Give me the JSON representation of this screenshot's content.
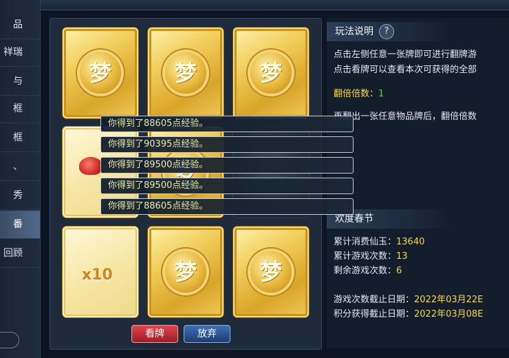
{
  "sidebar": {
    "items": [
      {
        "label": "品"
      },
      {
        "label": "祥瑞"
      },
      {
        "label": "与"
      },
      {
        "label": "框"
      },
      {
        "label": "框"
      },
      {
        "label": "、"
      },
      {
        "label": "秀"
      },
      {
        "label": "番"
      },
      {
        "label": "回顾"
      }
    ],
    "active_index": 7
  },
  "cards": [
    {
      "type": "back",
      "glyph": "梦"
    },
    {
      "type": "back",
      "glyph": "梦"
    },
    {
      "type": "back",
      "glyph": "梦"
    },
    {
      "type": "item"
    },
    {
      "type": "back",
      "glyph": "梦"
    },
    {
      "type": "dark"
    },
    {
      "type": "multiplier",
      "label": "x10"
    },
    {
      "type": "back",
      "glyph": "梦"
    },
    {
      "type": "back",
      "glyph": "梦"
    }
  ],
  "buttons": {
    "view": "看牌",
    "quit": "放弃"
  },
  "rules": {
    "title": "玩法说明",
    "help": "?",
    "line1": "点击左侧任意一张牌即可进行翻牌游",
    "line2": "点击看牌可以查看本次可获得的全部",
    "double_label": "翻倍倍数：",
    "double_value": "1",
    "line3": "再翻出一张任意物品牌后，翻倍倍数"
  },
  "event": {
    "title": "欢度春节",
    "spent_label": "累计消费仙玉：",
    "spent_value": "13640",
    "plays_label": "累计游戏次数：",
    "plays_value": "13",
    "remain_label": "剩余游戏次数：",
    "remain_value": "6",
    "deadline_label": "游戏次数截止日期：",
    "deadline_value": "2022年03月22E",
    "points_label": "积分获得截止日期：",
    "points_value": "2022年03月08E"
  },
  "messages": [
    "你得到了88605点经验。",
    "你得到了90395点经验。",
    "你得到了89500点经验。",
    "你得到了89500点经验。",
    "你得到了88605点经验。"
  ]
}
